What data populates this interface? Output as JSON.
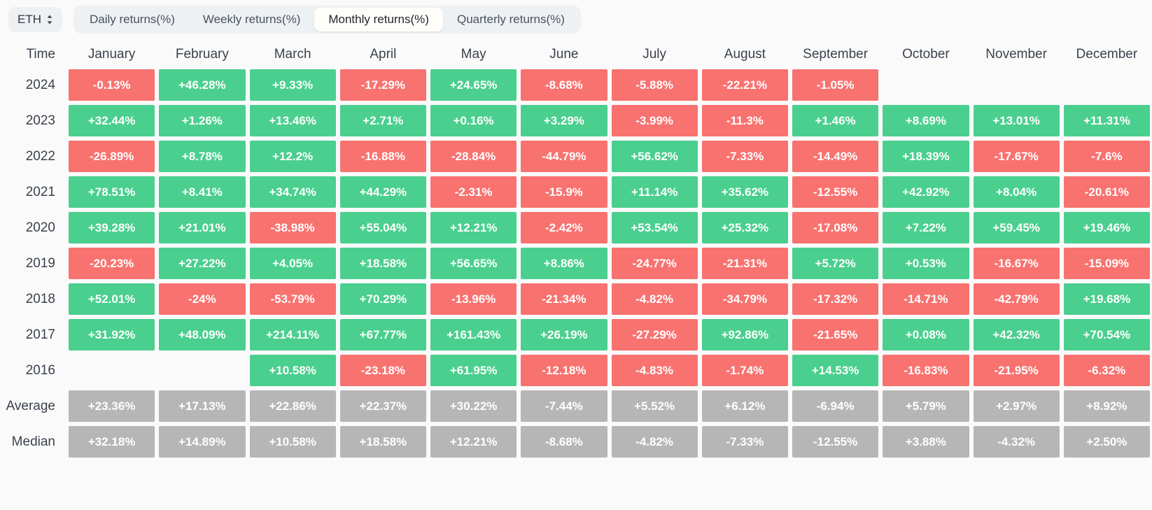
{
  "toolbar": {
    "asset": "ETH",
    "asset_chevron_icon": "chevron-up-down-icon",
    "tabs": [
      {
        "label": "Daily returns(%)",
        "active": false
      },
      {
        "label": "Weekly returns(%)",
        "active": false
      },
      {
        "label": "Monthly returns(%)",
        "active": true
      },
      {
        "label": "Quarterly returns(%)",
        "active": false
      }
    ]
  },
  "colors": {
    "positive": "#4ACF8E",
    "negative": "#F8726F",
    "neutral": "#B6B6B6",
    "page_background": "#FAFAFB",
    "tab_background": "#EEF1F4",
    "active_tab_background": "#FFFEFA",
    "text": "#3B424C"
  },
  "chart_data": {
    "type": "heatmap",
    "title": "Monthly returns(%)",
    "xlabel": "",
    "ylabel": "Time",
    "time_column_header": "Time",
    "categories": [
      "January",
      "February",
      "March",
      "April",
      "May",
      "June",
      "July",
      "August",
      "September",
      "October",
      "November",
      "December"
    ],
    "rows": [
      {
        "label": "2024",
        "kind": "year",
        "values": [
          "-0.13%",
          "+46.28%",
          "+9.33%",
          "-17.29%",
          "+24.65%",
          "-8.68%",
          "-5.88%",
          "-22.21%",
          "-1.05%",
          "",
          "",
          ""
        ],
        "signs": [
          "neg",
          "pos",
          "pos",
          "neg",
          "pos",
          "neg",
          "neg",
          "neg",
          "neg",
          "empty",
          "empty",
          "empty"
        ]
      },
      {
        "label": "2023",
        "kind": "year",
        "values": [
          "+32.44%",
          "+1.26%",
          "+13.46%",
          "+2.71%",
          "+0.16%",
          "+3.29%",
          "-3.99%",
          "-11.3%",
          "+1.46%",
          "+8.69%",
          "+13.01%",
          "+11.31%"
        ],
        "signs": [
          "pos",
          "pos",
          "pos",
          "pos",
          "pos",
          "pos",
          "neg",
          "neg",
          "pos",
          "pos",
          "pos",
          "pos"
        ]
      },
      {
        "label": "2022",
        "kind": "year",
        "values": [
          "-26.89%",
          "+8.78%",
          "+12.2%",
          "-16.88%",
          "-28.84%",
          "-44.79%",
          "+56.62%",
          "-7.33%",
          "-14.49%",
          "+18.39%",
          "-17.67%",
          "-7.6%"
        ],
        "signs": [
          "neg",
          "pos",
          "pos",
          "neg",
          "neg",
          "neg",
          "pos",
          "neg",
          "neg",
          "pos",
          "neg",
          "neg"
        ]
      },
      {
        "label": "2021",
        "kind": "year",
        "values": [
          "+78.51%",
          "+8.41%",
          "+34.74%",
          "+44.29%",
          "-2.31%",
          "-15.9%",
          "+11.14%",
          "+35.62%",
          "-12.55%",
          "+42.92%",
          "+8.04%",
          "-20.61%"
        ],
        "signs": [
          "pos",
          "pos",
          "pos",
          "pos",
          "neg",
          "neg",
          "pos",
          "pos",
          "neg",
          "pos",
          "pos",
          "neg"
        ]
      },
      {
        "label": "2020",
        "kind": "year",
        "values": [
          "+39.28%",
          "+21.01%",
          "-38.98%",
          "+55.04%",
          "+12.21%",
          "-2.42%",
          "+53.54%",
          "+25.32%",
          "-17.08%",
          "+7.22%",
          "+59.45%",
          "+19.46%"
        ],
        "signs": [
          "pos",
          "pos",
          "neg",
          "pos",
          "pos",
          "neg",
          "pos",
          "pos",
          "neg",
          "pos",
          "pos",
          "pos"
        ]
      },
      {
        "label": "2019",
        "kind": "year",
        "values": [
          "-20.23%",
          "+27.22%",
          "+4.05%",
          "+18.58%",
          "+56.65%",
          "+8.86%",
          "-24.77%",
          "-21.31%",
          "+5.72%",
          "+0.53%",
          "-16.67%",
          "-15.09%"
        ],
        "signs": [
          "neg",
          "pos",
          "pos",
          "pos",
          "pos",
          "pos",
          "neg",
          "neg",
          "pos",
          "pos",
          "neg",
          "neg"
        ]
      },
      {
        "label": "2018",
        "kind": "year",
        "values": [
          "+52.01%",
          "-24%",
          "-53.79%",
          "+70.29%",
          "-13.96%",
          "-21.34%",
          "-4.82%",
          "-34.79%",
          "-17.32%",
          "-14.71%",
          "-42.79%",
          "+19.68%"
        ],
        "signs": [
          "pos",
          "neg",
          "neg",
          "pos",
          "neg",
          "neg",
          "neg",
          "neg",
          "neg",
          "neg",
          "neg",
          "pos"
        ]
      },
      {
        "label": "2017",
        "kind": "year",
        "values": [
          "+31.92%",
          "+48.09%",
          "+214.11%",
          "+67.77%",
          "+161.43%",
          "+26.19%",
          "-27.29%",
          "+92.86%",
          "-21.65%",
          "+0.08%",
          "+42.32%",
          "+70.54%"
        ],
        "signs": [
          "pos",
          "pos",
          "pos",
          "pos",
          "pos",
          "pos",
          "neg",
          "pos",
          "neg",
          "pos",
          "pos",
          "pos"
        ]
      },
      {
        "label": "2016",
        "kind": "year",
        "values": [
          "",
          "",
          "+10.58%",
          "-23.18%",
          "+61.95%",
          "-12.18%",
          "-4.83%",
          "-1.74%",
          "+14.53%",
          "-16.83%",
          "-21.95%",
          "-6.32%"
        ],
        "signs": [
          "empty",
          "empty",
          "pos",
          "neg",
          "pos",
          "neg",
          "neg",
          "neg",
          "pos",
          "neg",
          "neg",
          "neg"
        ]
      },
      {
        "label": "Average",
        "kind": "summary",
        "values": [
          "+23.36%",
          "+17.13%",
          "+22.86%",
          "+22.37%",
          "+30.22%",
          "-7.44%",
          "+5.52%",
          "+6.12%",
          "-6.94%",
          "+5.79%",
          "+2.97%",
          "+8.92%"
        ],
        "signs": [
          "neu",
          "neu",
          "neu",
          "neu",
          "neu",
          "neu",
          "neu",
          "neu",
          "neu",
          "neu",
          "neu",
          "neu"
        ]
      },
      {
        "label": "Median",
        "kind": "summary",
        "values": [
          "+32.18%",
          "+14.89%",
          "+10.58%",
          "+18.58%",
          "+12.21%",
          "-8.68%",
          "-4.82%",
          "-7.33%",
          "-12.55%",
          "+3.88%",
          "-4.32%",
          "+2.50%"
        ],
        "signs": [
          "neu",
          "neu",
          "neu",
          "neu",
          "neu",
          "neu",
          "neu",
          "neu",
          "neu",
          "neu",
          "neu",
          "neu"
        ]
      }
    ]
  }
}
